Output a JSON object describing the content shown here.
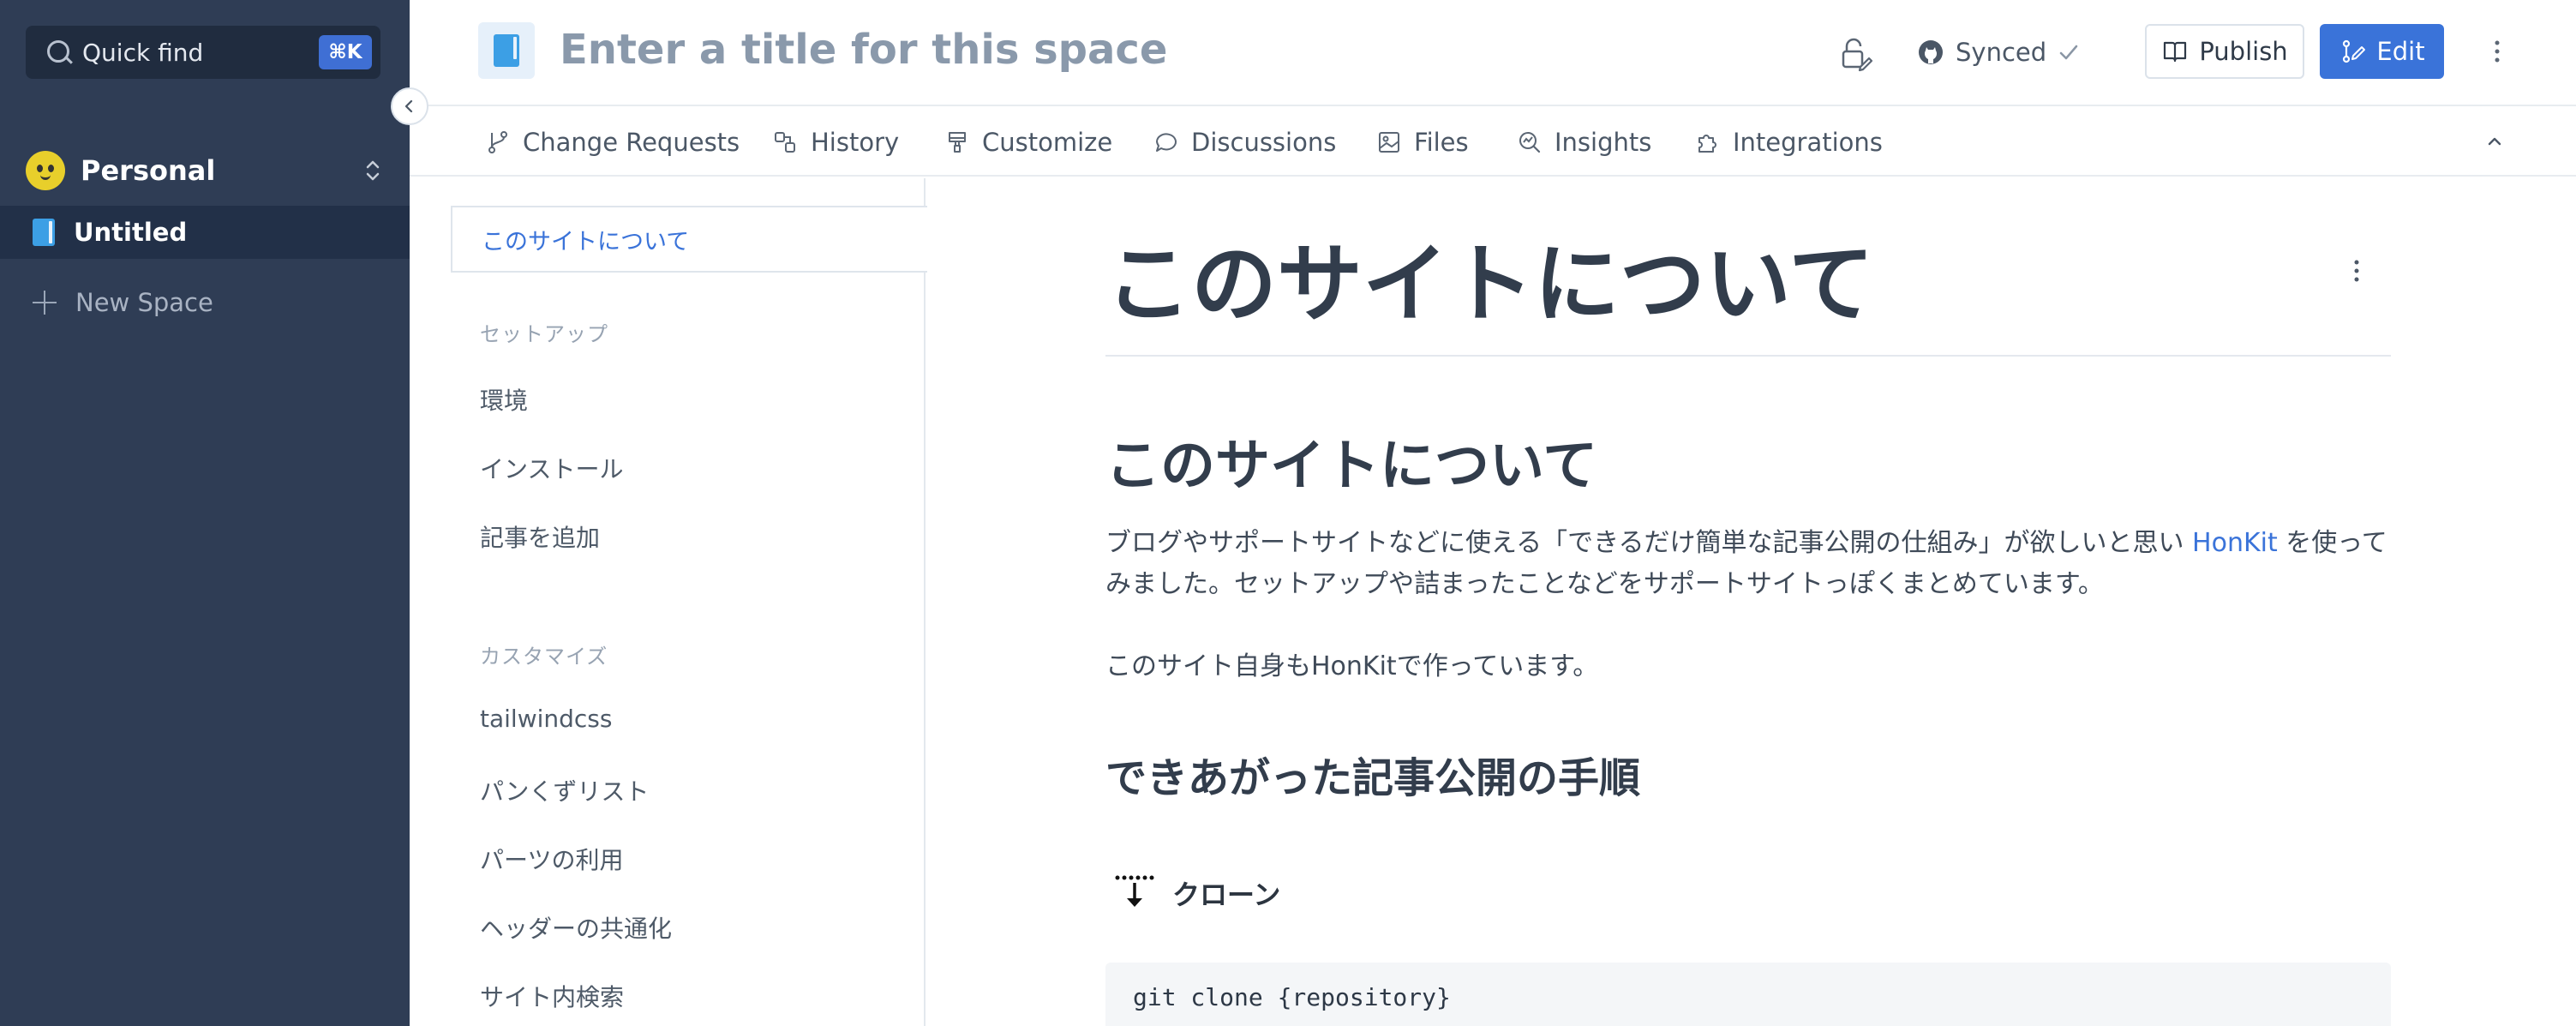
{
  "sidebar": {
    "quick_find": {
      "label": "Quick find",
      "shortcut": "⌘K"
    },
    "org": {
      "name": "Personal"
    },
    "spaces": [
      {
        "name": "Untitled"
      }
    ],
    "new_space_label": "New Space"
  },
  "header": {
    "title_placeholder": "Enter a title for this space",
    "synced_label": "Synced",
    "publish_label": "Publish",
    "edit_label": "Edit"
  },
  "tabs": [
    {
      "label": "Change Requests",
      "icon": "branch-icon"
    },
    {
      "label": "History",
      "icon": "history-icon"
    },
    {
      "label": "Customize",
      "icon": "brush-icon"
    },
    {
      "label": "Discussions",
      "icon": "chat-icon"
    },
    {
      "label": "Files",
      "icon": "image-icon"
    },
    {
      "label": "Insights",
      "icon": "insights-icon"
    },
    {
      "label": "Integrations",
      "icon": "puzzle-icon"
    }
  ],
  "toc": {
    "active": "このサイトについて",
    "sections": [
      {
        "title": "セットアップ",
        "items": [
          "環境",
          "インストール",
          "記事を追加"
        ]
      },
      {
        "title": "カスタマイズ",
        "items": [
          "tailwindcss",
          "パンくずリスト",
          "パーツの利用",
          "ヘッダーの共通化",
          "サイト内検索"
        ]
      }
    ]
  },
  "page": {
    "title": "このサイトについて",
    "h1": "このサイトについて",
    "para1_part1": "ブログやサポートサイトなどに使える「できるだけ簡単な記事公開の仕組み」が欲しいと思い ",
    "para1_link": "HonKit",
    "para1_part2": " を使ってみました。セットアップや詰まったことなどをサポートサイトっぽくまとめています。",
    "para2": "このサイト自身もHonKitで作っています。",
    "h2": "できあがった記事公開の手順",
    "step1_label": "クローン",
    "code": "git clone {repository}"
  },
  "colors": {
    "sidebar_bg": "#2f3d55",
    "accent": "#3a73d9",
    "title_placeholder": "#8a99ab"
  }
}
